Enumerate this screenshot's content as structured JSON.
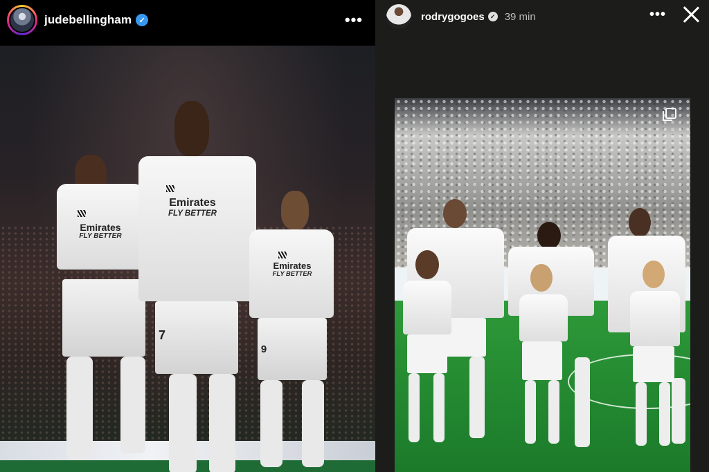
{
  "post": {
    "username": "judebellingham",
    "verified_glyph": "✓",
    "more_glyph": "•••",
    "avatar_icon": "profile-avatar",
    "image": {
      "jerseys": [
        {
          "sponsor_line1": "Emirates",
          "sponsor_line2": "FLY BETTER",
          "number": ""
        },
        {
          "sponsor_line1": "Emirates",
          "sponsor_line2": "FLY BETTER",
          "number": "7"
        },
        {
          "sponsor_line1": "Emirates",
          "sponsor_line2": "FLY BETTER",
          "number": "9"
        }
      ]
    }
  },
  "story": {
    "username": "rodrygogoes",
    "verified_glyph": "✓",
    "time": "39 min",
    "more_glyph": "•••",
    "close_icon": "close-icon",
    "copy_icon": "multiple-photos-icon"
  },
  "colors": {
    "background": "#000000",
    "story_background": "#1c1c1a",
    "verified_blue": "#3897f0",
    "pitch_green": "#2e9a39"
  }
}
